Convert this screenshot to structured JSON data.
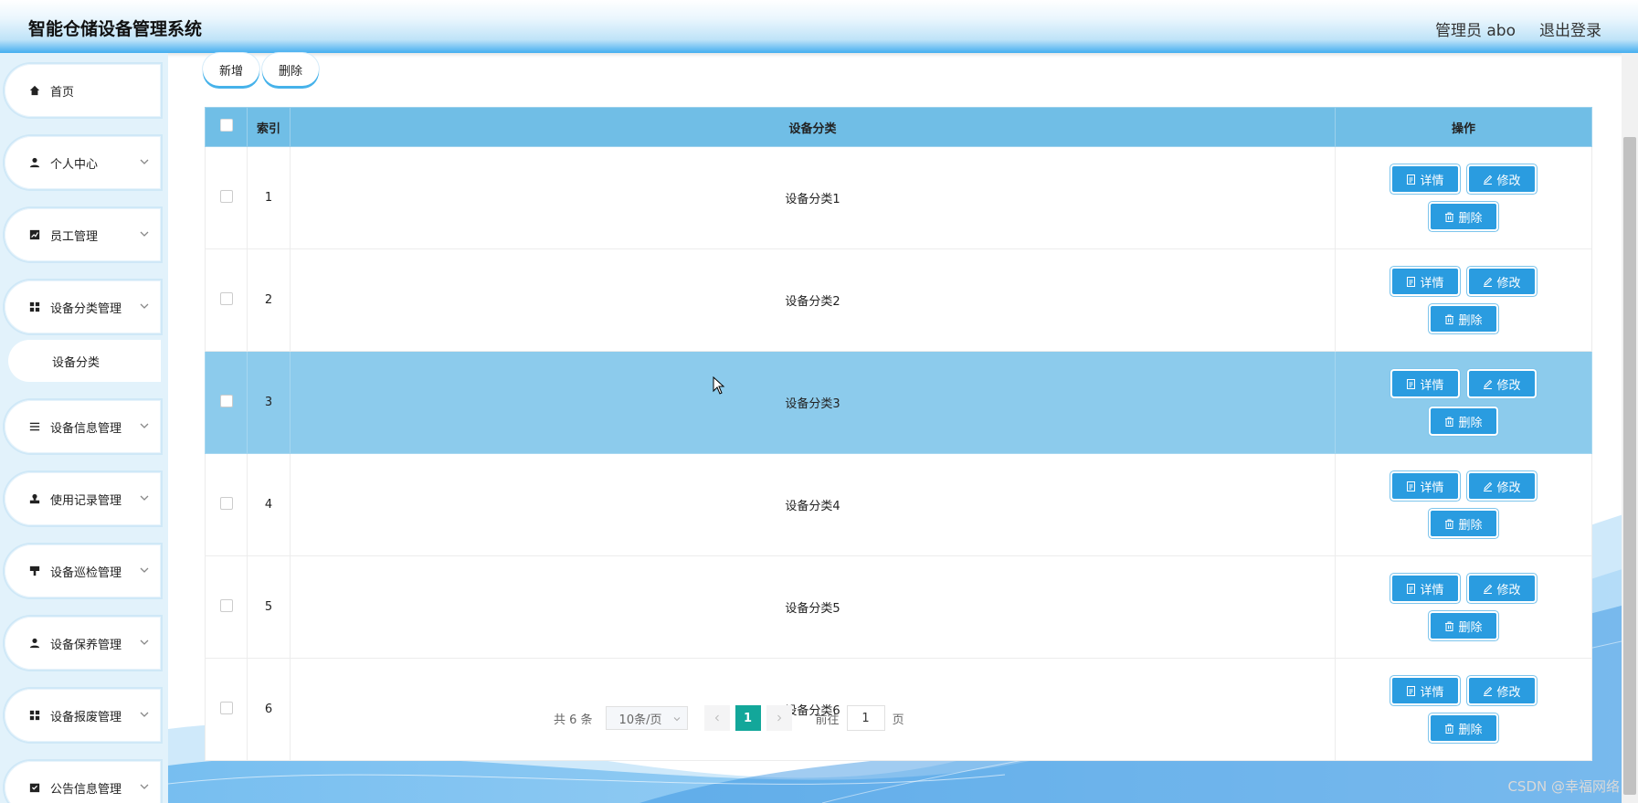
{
  "header": {
    "title": "智能仓储设备管理系统",
    "user": "管理员 abo",
    "logout": "退出登录"
  },
  "sidebar": {
    "items": [
      {
        "label": "首页",
        "icon": "home-icon"
      },
      {
        "label": "个人中心",
        "icon": "user-icon"
      },
      {
        "label": "员工管理",
        "icon": "chart-icon"
      },
      {
        "label": "设备分类管理",
        "icon": "grid-icon"
      },
      {
        "label": "设备信息管理",
        "icon": "list-icon"
      },
      {
        "label": "使用记录管理",
        "icon": "stamp-icon"
      },
      {
        "label": "设备巡检管理",
        "icon": "brush-icon"
      },
      {
        "label": "设备保养管理",
        "icon": "user-icon"
      },
      {
        "label": "设备报废管理",
        "icon": "grid-icon"
      },
      {
        "label": "公告信息管理",
        "icon": "checklist-icon"
      }
    ],
    "submenu": {
      "label": "设备分类"
    }
  },
  "toolbar": {
    "add": "新增",
    "delete": "删除"
  },
  "table": {
    "headers": {
      "index": "索引",
      "category": "设备分类",
      "actions": "操作"
    },
    "rows": [
      {
        "index": "1",
        "category": "设备分类1"
      },
      {
        "index": "2",
        "category": "设备分类2"
      },
      {
        "index": "3",
        "category": "设备分类3"
      },
      {
        "index": "4",
        "category": "设备分类4"
      },
      {
        "index": "5",
        "category": "设备分类5"
      },
      {
        "index": "6",
        "category": "设备分类6"
      }
    ],
    "action_labels": {
      "detail": "详情",
      "edit": "修改",
      "delete": "删除"
    }
  },
  "pagination": {
    "total": "共 6 条",
    "page_size": "10条/页",
    "current_page": "1",
    "goto_prefix": "前往",
    "goto_value": "1",
    "goto_suffix": "页"
  },
  "watermark": "CSDN @幸福网络",
  "colors": {
    "header_accent": "#44aef0",
    "table_header": "#70bee6",
    "highlight_row": "#8ccbec",
    "action_button": "#2a9ce0",
    "active_page": "#13a79a"
  }
}
